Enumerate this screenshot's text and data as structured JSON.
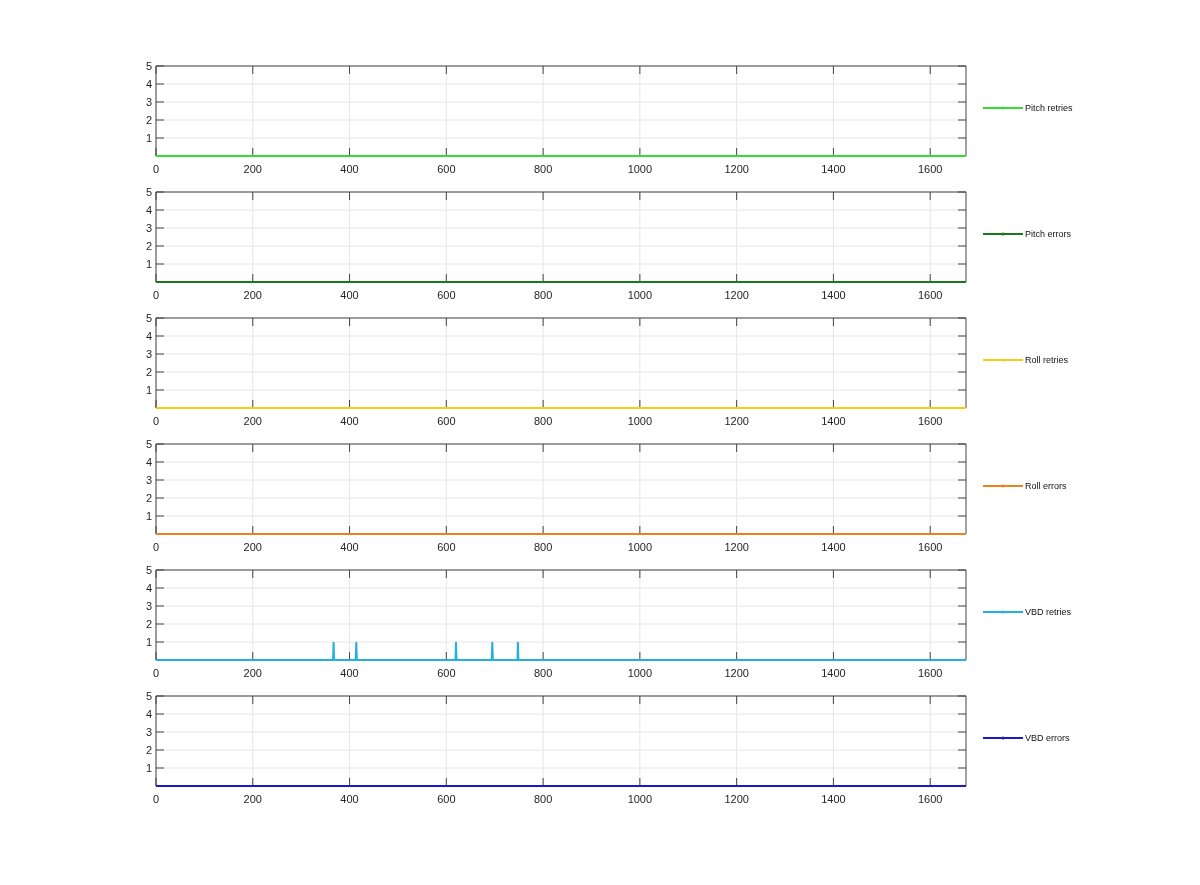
{
  "panels": [
    {
      "chart_data": {
        "type": "line",
        "grid": true,
        "x": [
          0,
          1674
        ],
        "xlim": [
          0,
          1674
        ],
        "ylim": [
          0,
          5
        ],
        "xticks": [
          0,
          200,
          400,
          600,
          800,
          1000,
          1200,
          1400,
          1600
        ],
        "yticks": [
          1,
          2,
          3,
          4,
          5
        ],
        "series": [
          {
            "name": "Pitch retries",
            "color": "#33dd33",
            "values": [
              0,
              0
            ]
          }
        ]
      }
    },
    {
      "chart_data": {
        "type": "line",
        "grid": true,
        "x": [
          0,
          1674
        ],
        "xlim": [
          0,
          1674
        ],
        "ylim": [
          0,
          5
        ],
        "xticks": [
          0,
          200,
          400,
          600,
          800,
          1000,
          1200,
          1400,
          1600
        ],
        "yticks": [
          1,
          2,
          3,
          4,
          5
        ],
        "series": [
          {
            "name": "Pitch errors",
            "color": "#1a7a1a",
            "values": [
              0,
              0
            ]
          }
        ]
      }
    },
    {
      "chart_data": {
        "type": "line",
        "grid": true,
        "x": [
          0,
          1674
        ],
        "xlim": [
          0,
          1674
        ],
        "ylim": [
          0,
          5
        ],
        "xticks": [
          0,
          200,
          400,
          600,
          800,
          1000,
          1200,
          1400,
          1600
        ],
        "yticks": [
          1,
          2,
          3,
          4,
          5
        ],
        "series": [
          {
            "name": "Roll retries",
            "color": "#f5cc1a",
            "values": [
              0,
              0
            ]
          }
        ]
      }
    },
    {
      "chart_data": {
        "type": "line",
        "grid": true,
        "x": [
          0,
          1674
        ],
        "xlim": [
          0,
          1674
        ],
        "ylim": [
          0,
          5
        ],
        "xticks": [
          0,
          200,
          400,
          600,
          800,
          1000,
          1200,
          1400,
          1600
        ],
        "yticks": [
          1,
          2,
          3,
          4,
          5
        ],
        "series": [
          {
            "name": "Roll errors",
            "color": "#ee8020",
            "values": [
              0,
              0
            ]
          }
        ]
      }
    },
    {
      "chart_data": {
        "type": "line",
        "grid": true,
        "x": [
          0,
          366,
          367,
          368,
          413,
          414,
          415,
          619,
          620,
          621,
          694,
          695,
          696,
          747,
          748,
          749,
          1674
        ],
        "xlim": [
          0,
          1674
        ],
        "ylim": [
          0,
          5
        ],
        "xticks": [
          0,
          200,
          400,
          600,
          800,
          1000,
          1200,
          1400,
          1600
        ],
        "yticks": [
          1,
          2,
          3,
          4,
          5
        ],
        "series": [
          {
            "name": "VBD retries",
            "color": "#22b0e0",
            "values": [
              0,
              0,
              1,
              0,
              0,
              1,
              0,
              0,
              1,
              0,
              0,
              1,
              0,
              0,
              1,
              0,
              0
            ]
          }
        ]
      }
    },
    {
      "chart_data": {
        "type": "line",
        "grid": true,
        "x": [
          0,
          1674
        ],
        "xlim": [
          0,
          1674
        ],
        "ylim": [
          0,
          5
        ],
        "xticks": [
          0,
          200,
          400,
          600,
          800,
          1000,
          1200,
          1400,
          1600
        ],
        "yticks": [
          1,
          2,
          3,
          4,
          5
        ],
        "series": [
          {
            "name": "VBD errors",
            "color": "#1a1acc",
            "values": [
              0,
              0
            ]
          }
        ]
      }
    }
  ]
}
